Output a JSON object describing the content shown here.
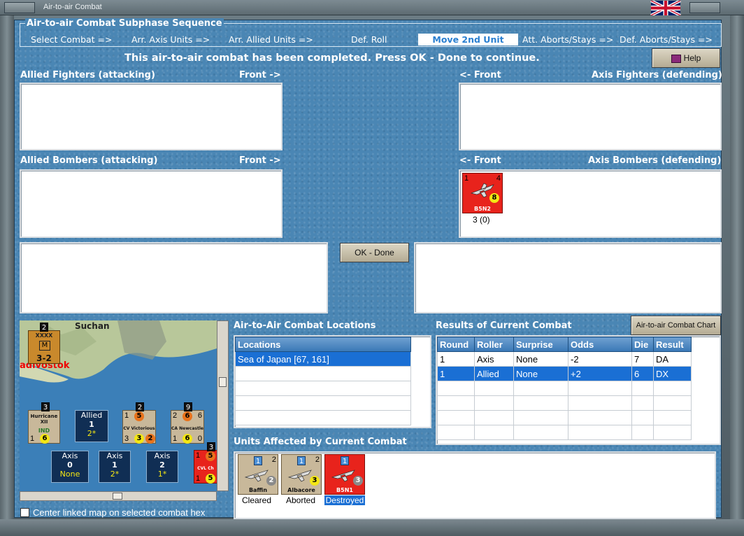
{
  "window": {
    "title": "Air-to-air Combat"
  },
  "sequence": {
    "title": "Air-to-air Combat Subphase Sequence",
    "steps": [
      "Select Combat =>",
      "Arr. Axis Units =>",
      "Arr. Allied Units =>",
      "Def. Roll",
      "Move 2nd Unit",
      "Att. Aborts/Stays =>",
      "Def. Aborts/Stays =>"
    ],
    "active": "Move 2nd Unit"
  },
  "status_message": "This air-to-air combat has been completed.  Press OK - Done to continue.",
  "help_label": "Help",
  "panels": {
    "allied_fighters": "Allied Fighters (attacking)",
    "allied_bombers": "Allied Bombers (attacking)",
    "axis_fighters": "Axis Fighters (defending)",
    "axis_bombers": "Axis Bombers (defending)",
    "front_right": "Front ->",
    "front_left": "<- Front"
  },
  "axis_bomber_unit": {
    "tl": "1",
    "tr": "4",
    "strength": "8",
    "name": "B5N2",
    "caption": "3 (0)"
  },
  "ok_done_label": "OK - Done",
  "map": {
    "place": "Suchan",
    "city": "adivostok",
    "corps_counter": {
      "stack": "2",
      "top": "XXXX",
      "side": "Vladivostok",
      "value": "3-2"
    },
    "unit_counters": [
      {
        "stack": "3",
        "name": "Hurricane XII",
        "sub": "IND",
        "a": "5",
        "b": "1",
        "c": "6"
      },
      {
        "stack": "2",
        "name": "CV Victorious",
        "a": "1",
        "b": "5",
        "c": "3",
        "d": "3",
        "e": "2"
      },
      {
        "stack": "9",
        "name": "CA Newcastle",
        "a": "2",
        "b": "6",
        "c": "6",
        "d": "1",
        "e": "6",
        "f": "0"
      },
      {
        "stack": "3",
        "name": "CVL Ch",
        "a": "1",
        "b": "5",
        "c": "1",
        "d": "5"
      }
    ],
    "allied_box": {
      "label": "Allied",
      "value": "1",
      "sub": "2*"
    },
    "axis_boxes": [
      {
        "label": "Axis",
        "value": "0",
        "sub": "None"
      },
      {
        "label": "Axis",
        "value": "1",
        "sub": "2*"
      },
      {
        "label": "Axis",
        "value": "2",
        "sub": "1*"
      }
    ]
  },
  "center_map_label": "Center linked map on selected combat hex",
  "locations": {
    "title": "Air-to-Air Combat Locations",
    "header": "Locations",
    "rows": [
      "Sea of Japan [67, 161]"
    ]
  },
  "results": {
    "title": "Results of Current Combat",
    "chart_button": "Air-to-air Combat Chart",
    "headers": [
      "Round",
      "Roller",
      "Surprise",
      "Odds",
      "Die",
      "Result"
    ],
    "rows": [
      [
        "1",
        "Axis",
        "None",
        "-2",
        "7",
        "DA"
      ],
      [
        "1",
        "Allied",
        "None",
        "+2",
        "6",
        "DX"
      ]
    ]
  },
  "affected": {
    "title": "Units Affected by Current Combat",
    "units": [
      {
        "name": "Baffin",
        "status": "Cleared",
        "a": "1",
        "b": "2",
        "c": "2",
        "d": "3"
      },
      {
        "name": "Albacore",
        "status": "Aborted",
        "a": "1",
        "b": "2",
        "c": "8",
        "d": "3"
      },
      {
        "name": "B5N1",
        "status": "Destroyed",
        "a": "1",
        "b": "3",
        "c": "4",
        "d": "3"
      }
    ]
  }
}
